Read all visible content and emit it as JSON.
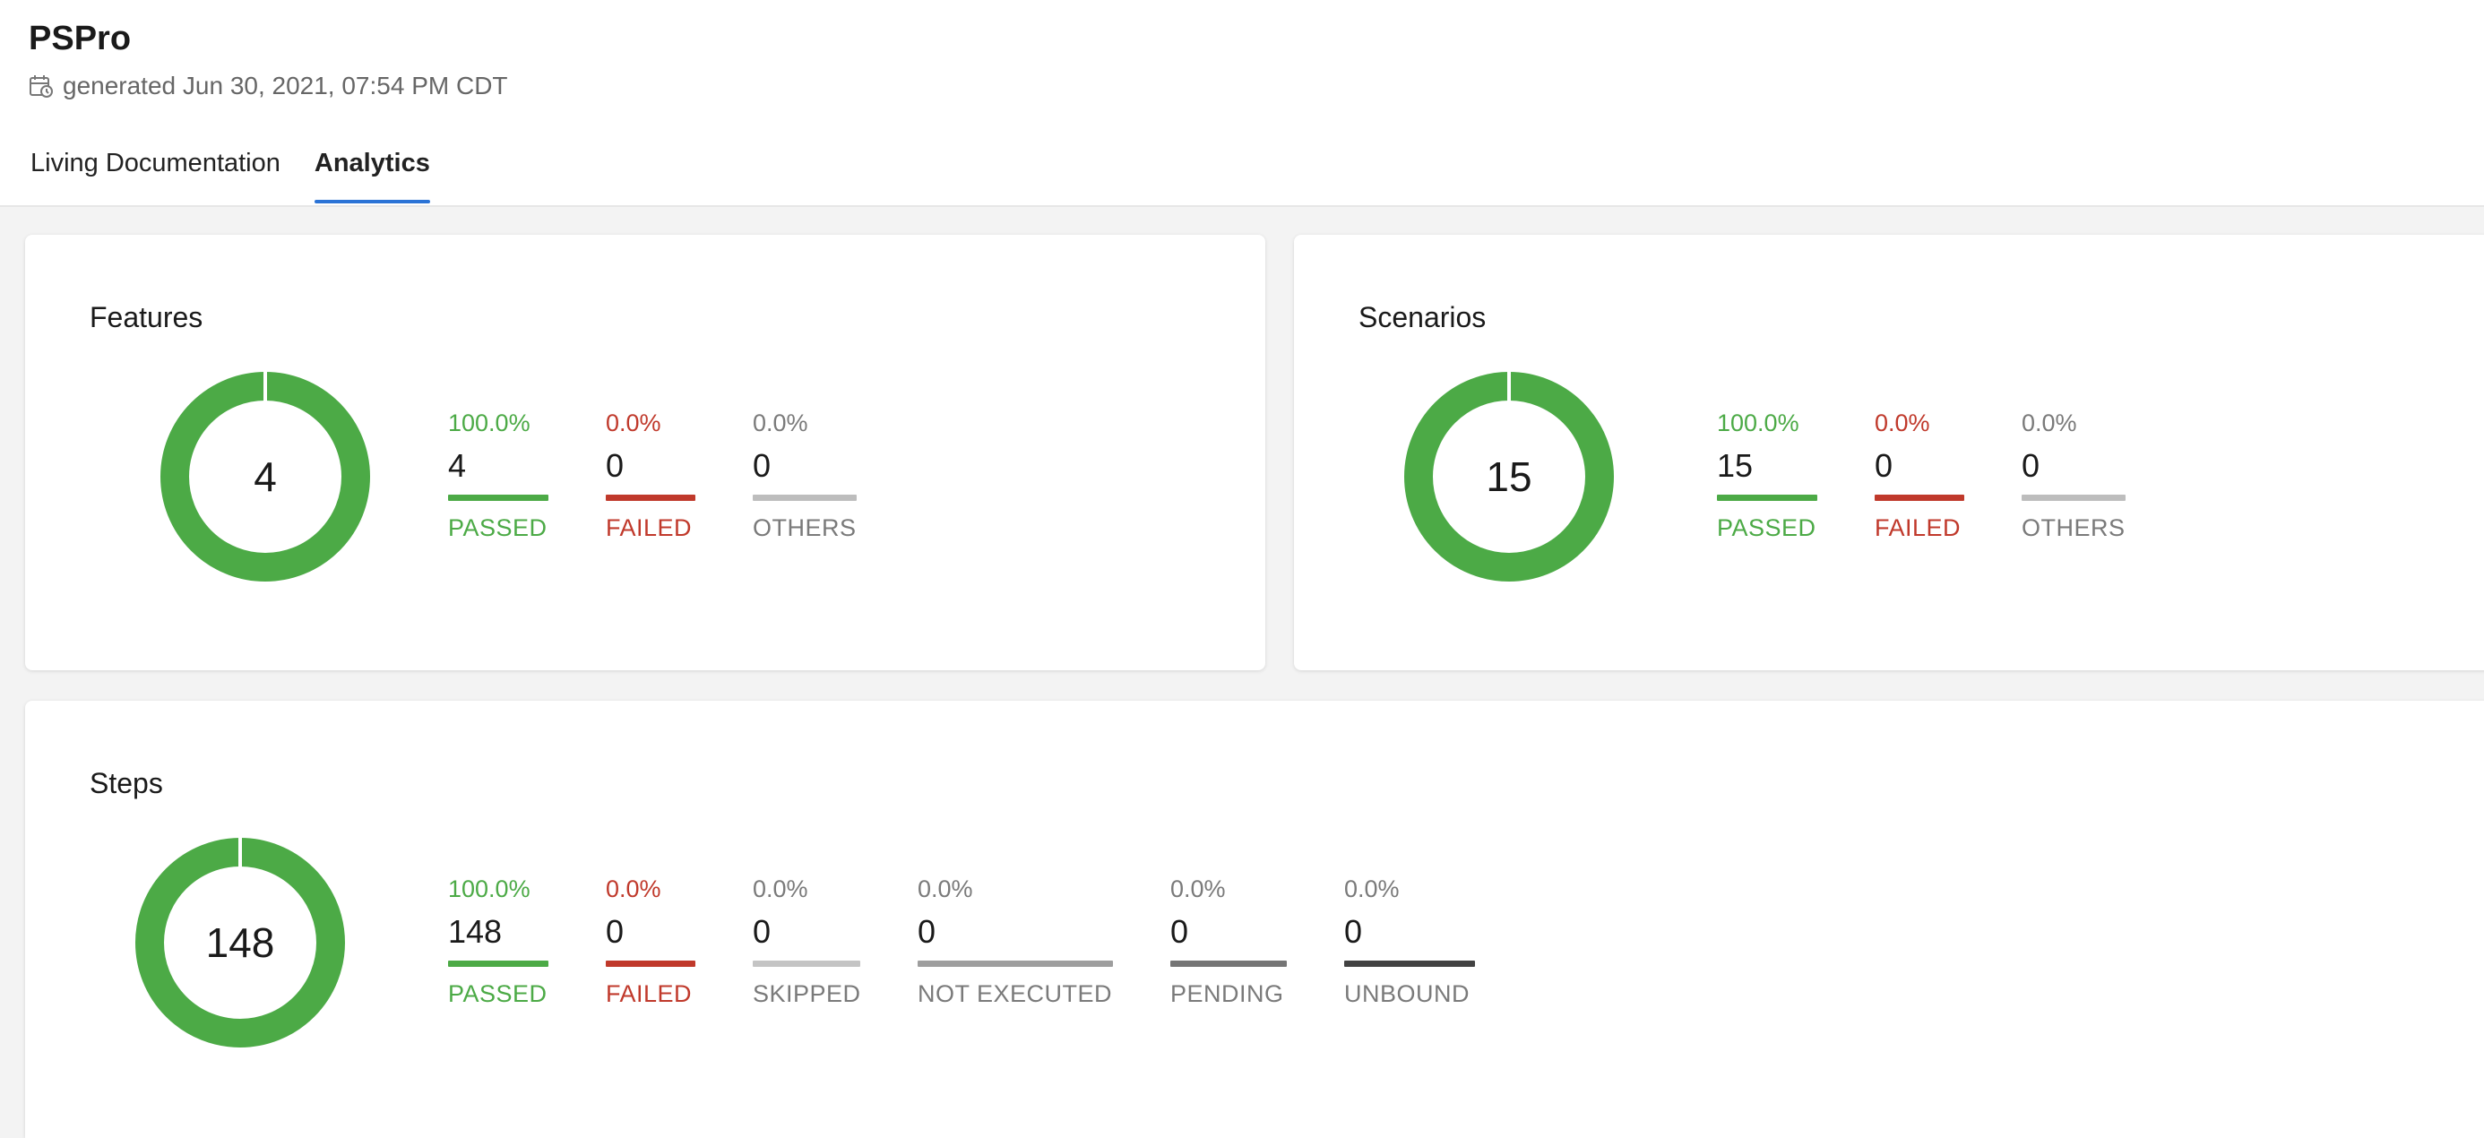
{
  "header": {
    "title": "PSPro",
    "generated": "generated Jun 30, 2021, 07:54 PM CDT",
    "calendar_icon": "calendar-clock-icon"
  },
  "tabs": [
    {
      "label": "Living Documentation",
      "active": false
    },
    {
      "label": "Analytics",
      "active": true
    }
  ],
  "colors": {
    "passed": "#4caa46",
    "failed": "#c0392b",
    "others": "#bdbdbd",
    "skipped": "#c4c4c4",
    "not_executed": "#9e9e9e",
    "pending": "#757575",
    "unbound": "#424242",
    "accent": "#2b73d6"
  },
  "features": {
    "title": "Features",
    "total": "4",
    "passed_fraction": 1.0,
    "stats": [
      {
        "pct": "100.0%",
        "count": "4",
        "label": "PASSED"
      },
      {
        "pct": "0.0%",
        "count": "0",
        "label": "FAILED"
      },
      {
        "pct": "0.0%",
        "count": "0",
        "label": "OTHERS"
      }
    ]
  },
  "scenarios": {
    "title": "Scenarios",
    "total": "15",
    "passed_fraction": 1.0,
    "stats": [
      {
        "pct": "100.0%",
        "count": "15",
        "label": "PASSED"
      },
      {
        "pct": "0.0%",
        "count": "0",
        "label": "FAILED"
      },
      {
        "pct": "0.0%",
        "count": "0",
        "label": "OTHERS"
      }
    ]
  },
  "steps": {
    "title": "Steps",
    "total": "148",
    "passed_fraction": 1.0,
    "stats": [
      {
        "pct": "100.0%",
        "count": "148",
        "label": "PASSED"
      },
      {
        "pct": "0.0%",
        "count": "0",
        "label": "FAILED"
      },
      {
        "pct": "0.0%",
        "count": "0",
        "label": "SKIPPED"
      },
      {
        "pct": "0.0%",
        "count": "0",
        "label": "NOT EXECUTED"
      },
      {
        "pct": "0.0%",
        "count": "0",
        "label": "PENDING"
      },
      {
        "pct": "0.0%",
        "count": "0",
        "label": "UNBOUND"
      }
    ]
  }
}
